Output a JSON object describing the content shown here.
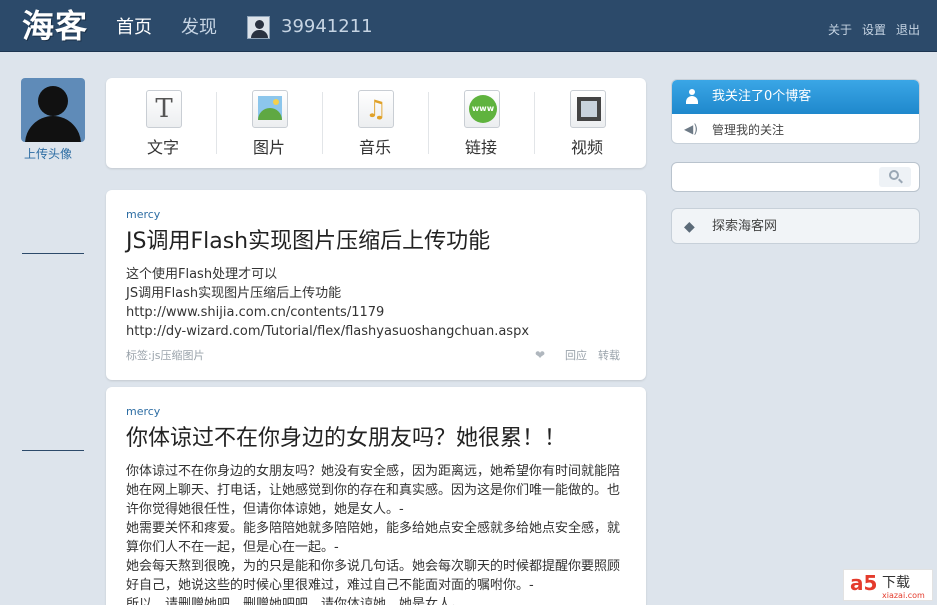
{
  "header": {
    "logo": "海客",
    "nav": [
      {
        "label": "首页",
        "active": true
      },
      {
        "label": "发现",
        "active": false
      }
    ],
    "user_id": "39941211",
    "links": [
      "关于",
      "设置",
      "退出"
    ]
  },
  "left": {
    "upload_avatar": "上传头像"
  },
  "post_types": [
    {
      "label": "文字",
      "icon": "text-icon"
    },
    {
      "label": "图片",
      "icon": "picture-icon"
    },
    {
      "label": "音乐",
      "icon": "music-icon"
    },
    {
      "label": "链接",
      "icon": "link-icon"
    },
    {
      "label": "视频",
      "icon": "video-icon"
    }
  ],
  "icon_text_glyph": "T",
  "icon_link_text": "www",
  "posts": [
    {
      "author": "mercy",
      "title": "JS调用Flash实现图片压缩后上传功能",
      "body": [
        "这个使用Flash处理才可以",
        "JS调用Flash实现图片压缩后上传功能",
        "http://www.shijia.com.cn/contents/1179",
        "http://dy-wizard.com/Tutorial/flex/flashyasuoshangchuan.aspx"
      ],
      "tags": "标签:js压缩图片",
      "reply": "回应",
      "repost": "转载"
    },
    {
      "author": "mercy",
      "title": "你体谅过不在你身边的女朋友吗？她很累！！",
      "body": [
        "你体谅过不在你身边的女朋友吗？她没有安全感，因为距离远，她希望你有时间就能陪她在网上聊天、打电话，让她感觉到你的存在和真实感。因为这是你们唯一能做的。也许你觉得她很任性，但请你体谅她，她是女人。-",
        "她需要关怀和疼爱。能多陪陪她就多陪陪她，能多给她点安全感就多给她点安全感，就算你们人不在一起，但是心在一起。-",
        "她会每天熬到很晚，为的只是能和你多说几句话。她会每次聊天的时候都提醒你要照顾好自己，她说这些的时候心里很难过，难过自己不能面对面的嘱咐你。-",
        "所以，请删赠她吧，删赠她吧吧，请你体谅她，她是女人。"
      ]
    }
  ],
  "sidebar": {
    "following": "我关注了0个博客",
    "manage": "管理我的关注",
    "search_placeholder": "",
    "explore": "探索海客网"
  },
  "watermark": {
    "logo": "a5",
    "text": "下载",
    "site": "xiazai.com"
  },
  "colors": {
    "header_bg": "#2c4a6a",
    "page_bg": "#dde4ec",
    "accent_blue": "#1f88cc",
    "link_blue": "#2d6da3"
  }
}
